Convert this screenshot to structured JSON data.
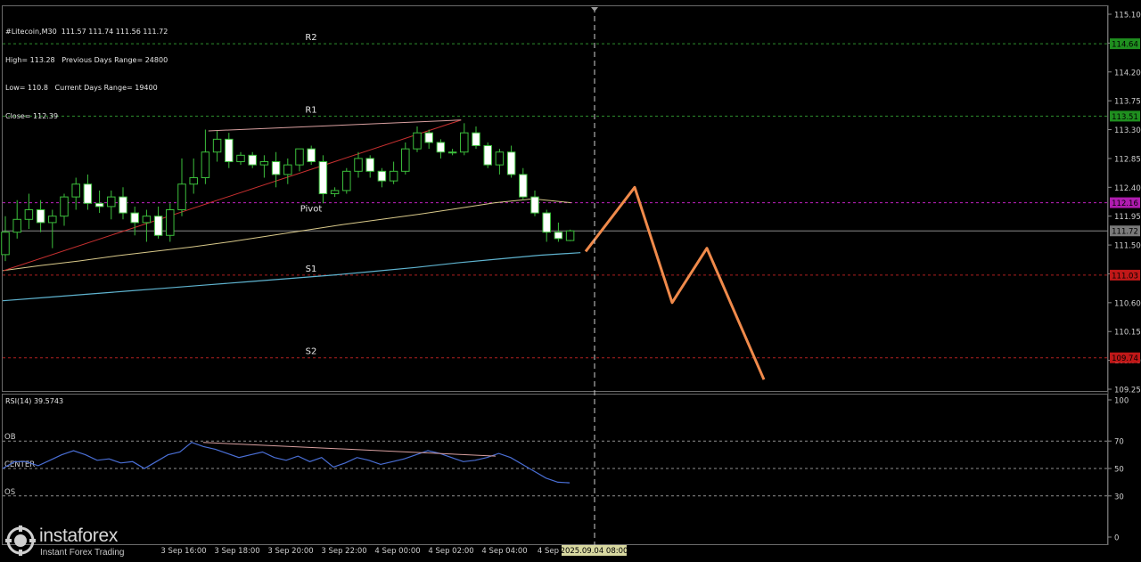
{
  "info": {
    "symbol_line": "#Litecoin,M30  111.57 111.74 111.56 111.72",
    "high_line": "High= 113.28   Previous Days Range= 24800",
    "low_line": "Low= 110.8   Current Days Range= 19400",
    "close_line": "Close= 112.39"
  },
  "rsi_label": "RSI(14) 39.5743",
  "logo": {
    "name": "instaforex",
    "tagline": "Instant Forex Trading"
  },
  "colors": {
    "bg": "#000000",
    "grid": "#2a2a2a",
    "bull": "#000000",
    "bear": "#ffffff",
    "wick": "#3cbf3c",
    "forecast": "#f08a4b",
    "ma_fast": "#d9c98a",
    "ma_slow": "#5fb4d0",
    "trend_red": "#c83030",
    "trend_pink": "#d9a0a0",
    "rsi_line": "#4a6fd6",
    "pivot_line": "#c020c0",
    "r_line": "#2e8f2e",
    "s_line": "#b02020"
  },
  "chart_data": {
    "type": "candlestick",
    "symbol": "#Litecoin,M30",
    "ylim": [
      109.1,
      115.2
    ],
    "y_ticks": [
      "115.10",
      "114.65",
      "114.20",
      "113.75",
      "113.30",
      "112.85",
      "112.40",
      "111.95",
      "111.50",
      "111.05",
      "110.60",
      "110.15",
      "109.70",
      "109.25"
    ],
    "x_ticks": [
      "3 Sep 16:00",
      "3 Sep 18:00",
      "3 Sep 20:00",
      "3 Sep 22:00",
      "4 Sep 00:00",
      "4 Sep 02:00",
      "4 Sep 04:00",
      "4 Sep"
    ],
    "cursor_time_label": "2025.09.04 08:00",
    "levels": [
      {
        "name": "R2",
        "value": 114.64,
        "label": "114.64",
        "kind": "resistance"
      },
      {
        "name": "R1",
        "value": 113.51,
        "label": "113.51",
        "kind": "resistance"
      },
      {
        "name": "Pivot",
        "value": 112.16,
        "label": "112.16",
        "kind": "pivot"
      },
      {
        "name": "S1",
        "value": 111.03,
        "label": "111.03",
        "kind": "support"
      },
      {
        "name": "S2",
        "value": 109.74,
        "label": "109.74",
        "kind": "support"
      }
    ],
    "current_price": {
      "value": 111.72,
      "label": "111.72"
    },
    "candles": [
      {
        "o": 111.35,
        "h": 111.95,
        "l": 111.25,
        "c": 111.7
      },
      {
        "o": 111.7,
        "h": 112.2,
        "l": 111.6,
        "c": 111.9
      },
      {
        "o": 111.9,
        "h": 112.3,
        "l": 111.75,
        "c": 112.05
      },
      {
        "o": 112.05,
        "h": 112.2,
        "l": 111.7,
        "c": 111.85
      },
      {
        "o": 111.85,
        "h": 112.05,
        "l": 111.45,
        "c": 111.95
      },
      {
        "o": 111.95,
        "h": 112.3,
        "l": 111.8,
        "c": 112.25
      },
      {
        "o": 112.25,
        "h": 112.55,
        "l": 112.05,
        "c": 112.45
      },
      {
        "o": 112.45,
        "h": 112.6,
        "l": 112.05,
        "c": 112.15
      },
      {
        "o": 112.15,
        "h": 112.35,
        "l": 112.0,
        "c": 112.1
      },
      {
        "o": 112.1,
        "h": 112.35,
        "l": 111.9,
        "c": 112.25
      },
      {
        "o": 112.25,
        "h": 112.4,
        "l": 111.9,
        "c": 112.0
      },
      {
        "o": 112.0,
        "h": 112.1,
        "l": 111.65,
        "c": 111.85
      },
      {
        "o": 111.85,
        "h": 112.05,
        "l": 111.55,
        "c": 111.95
      },
      {
        "o": 111.95,
        "h": 112.1,
        "l": 111.6,
        "c": 111.65
      },
      {
        "o": 111.65,
        "h": 112.15,
        "l": 111.55,
        "c": 112.05
      },
      {
        "o": 112.05,
        "h": 112.85,
        "l": 111.95,
        "c": 112.45
      },
      {
        "o": 112.45,
        "h": 112.85,
        "l": 112.3,
        "c": 112.55
      },
      {
        "o": 112.55,
        "h": 113.3,
        "l": 112.45,
        "c": 112.95
      },
      {
        "o": 112.95,
        "h": 113.28,
        "l": 112.8,
        "c": 113.15
      },
      {
        "o": 113.15,
        "h": 113.25,
        "l": 112.7,
        "c": 112.8
      },
      {
        "o": 112.8,
        "h": 112.95,
        "l": 112.75,
        "c": 112.9
      },
      {
        "o": 112.9,
        "h": 112.95,
        "l": 112.7,
        "c": 112.75
      },
      {
        "o": 112.75,
        "h": 112.9,
        "l": 112.55,
        "c": 112.8
      },
      {
        "o": 112.8,
        "h": 112.95,
        "l": 112.4,
        "c": 112.6
      },
      {
        "o": 112.6,
        "h": 112.85,
        "l": 112.45,
        "c": 112.75
      },
      {
        "o": 112.75,
        "h": 113.0,
        "l": 112.65,
        "c": 113.0
      },
      {
        "o": 113.0,
        "h": 113.05,
        "l": 112.75,
        "c": 112.8
      },
      {
        "o": 112.8,
        "h": 112.9,
        "l": 112.15,
        "c": 112.3
      },
      {
        "o": 112.3,
        "h": 112.4,
        "l": 112.25,
        "c": 112.35
      },
      {
        "o": 112.35,
        "h": 112.7,
        "l": 112.3,
        "c": 112.65
      },
      {
        "o": 112.65,
        "h": 112.95,
        "l": 112.55,
        "c": 112.85
      },
      {
        "o": 112.85,
        "h": 112.9,
        "l": 112.55,
        "c": 112.65
      },
      {
        "o": 112.65,
        "h": 112.7,
        "l": 112.4,
        "c": 112.5
      },
      {
        "o": 112.5,
        "h": 112.8,
        "l": 112.45,
        "c": 112.65
      },
      {
        "o": 112.65,
        "h": 113.1,
        "l": 112.6,
        "c": 113.0
      },
      {
        "o": 113.0,
        "h": 113.35,
        "l": 112.95,
        "c": 113.25
      },
      {
        "o": 113.25,
        "h": 113.3,
        "l": 113.0,
        "c": 113.1
      },
      {
        "o": 113.1,
        "h": 113.15,
        "l": 112.85,
        "c": 112.95
      },
      {
        "o": 112.95,
        "h": 113.0,
        "l": 112.9,
        "c": 112.95
      },
      {
        "o": 112.95,
        "h": 113.4,
        "l": 112.9,
        "c": 113.25
      },
      {
        "o": 113.25,
        "h": 113.35,
        "l": 113.0,
        "c": 113.05
      },
      {
        "o": 113.05,
        "h": 113.1,
        "l": 112.7,
        "c": 112.75
      },
      {
        "o": 112.75,
        "h": 113.0,
        "l": 112.6,
        "c": 112.95
      },
      {
        "o": 112.95,
        "h": 113.05,
        "l": 112.55,
        "c": 112.6
      },
      {
        "o": 112.6,
        "h": 112.7,
        "l": 112.2,
        "c": 112.25
      },
      {
        "o": 112.25,
        "h": 112.35,
        "l": 111.95,
        "c": 112.0
      },
      {
        "o": 112.0,
        "h": 112.05,
        "l": 111.55,
        "c": 111.7
      },
      {
        "o": 111.7,
        "h": 111.85,
        "l": 111.55,
        "c": 111.6
      },
      {
        "o": 111.57,
        "h": 111.74,
        "l": 111.56,
        "c": 111.72
      }
    ],
    "ma_fast": [
      111.1,
      111.18,
      111.25,
      111.33,
      111.4,
      111.47,
      111.55,
      111.64,
      111.73,
      111.82,
      111.9,
      111.98,
      112.07,
      112.16,
      112.22,
      112.16
    ],
    "ma_slow": [
      110.63,
      110.68,
      110.73,
      110.78,
      110.83,
      110.88,
      110.93,
      110.98,
      111.03,
      111.09,
      111.15,
      111.22,
      111.28,
      111.34,
      111.38
    ],
    "trendline_red": [
      {
        "i": 0,
        "v": 111.1
      },
      {
        "i": 31,
        "v": 113.45
      }
    ],
    "trendline_top": [
      {
        "i": 13,
        "v": 113.28
      },
      {
        "i": 31,
        "v": 113.45
      }
    ],
    "forecast_path": [
      111.4,
      112.4,
      110.6,
      111.45,
      109.4
    ],
    "rsi": {
      "name": "RSI(14)",
      "value": 39.5743,
      "ylim": [
        0,
        100
      ],
      "y_ticks": [
        100,
        70,
        50,
        30,
        0
      ],
      "levels": [
        {
          "name": "OB",
          "value": 70
        },
        {
          "name": "CENTER",
          "value": 50
        },
        {
          "name": "OS",
          "value": 30
        }
      ],
      "values": [
        50,
        55,
        55,
        52,
        56,
        60,
        63,
        60,
        56,
        57,
        54,
        55,
        50,
        55,
        60,
        62,
        69,
        66,
        64,
        61,
        58,
        60,
        62,
        58,
        56,
        59,
        55,
        58,
        51,
        54,
        58,
        56,
        53,
        55,
        57,
        60,
        63,
        61,
        58,
        55,
        56,
        58,
        61,
        58,
        53,
        48,
        43,
        40,
        39.57
      ]
    }
  }
}
